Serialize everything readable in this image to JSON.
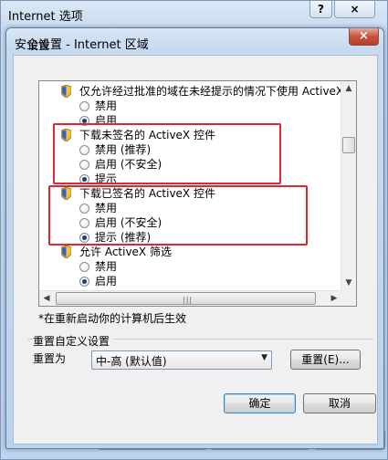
{
  "outer_window": {
    "title": "Internet 选项",
    "help_label": "?",
    "close_label": "×"
  },
  "dialog": {
    "title": "安全设置 - Internet 区域",
    "close_label": "×"
  },
  "settings_label": "设置",
  "list": {
    "rows": [
      {
        "kind": "heading",
        "text": "仅允许经过批准的域在未经提示的情况下使用 ActiveX"
      },
      {
        "kind": "option",
        "text": "禁用",
        "checked": false
      },
      {
        "kind": "option",
        "text": "启用",
        "checked": true
      },
      {
        "kind": "heading",
        "text": "下载未签名的 ActiveX 控件"
      },
      {
        "kind": "option",
        "text": "禁用 (推荐)",
        "checked": false
      },
      {
        "kind": "option",
        "text": "启用 (不安全)",
        "checked": false
      },
      {
        "kind": "option",
        "text": "提示",
        "checked": true
      },
      {
        "kind": "heading",
        "text": "下载已签名的 ActiveX 控件"
      },
      {
        "kind": "option",
        "text": "禁用",
        "checked": false
      },
      {
        "kind": "option",
        "text": "启用 (不安全)",
        "checked": false
      },
      {
        "kind": "option",
        "text": "提示 (推荐)",
        "checked": true
      },
      {
        "kind": "heading",
        "text": "允许 ActiveX 筛选"
      },
      {
        "kind": "option",
        "text": "禁用",
        "checked": false
      },
      {
        "kind": "option",
        "text": "启用",
        "checked": true
      }
    ]
  },
  "note": "*在重新启动你的计算机后生效",
  "reset_group": {
    "title": "重置自定义设置",
    "label": "重置为",
    "selected": "中-高 (默认值)",
    "reset_button": "重置(E)..."
  },
  "buttons": {
    "ok": "确定",
    "cancel": "取消"
  },
  "colors": {
    "highlight_box": "#e0262e",
    "dialog_frame": "#5d7ea5"
  }
}
